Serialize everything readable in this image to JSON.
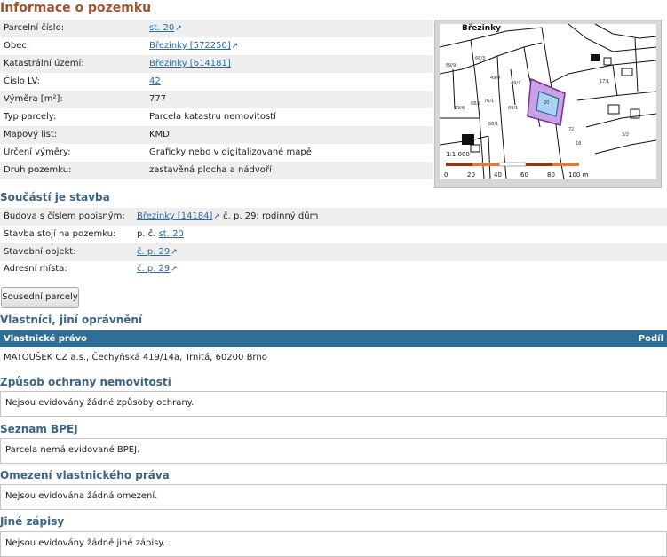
{
  "heading": "Informace o pozemku",
  "parcel_rows": [
    {
      "label": "Parcelní číslo:",
      "value": "st. 20",
      "link": true
    },
    {
      "label": "Obec:",
      "value": "Březinky [572250]",
      "link": true
    },
    {
      "label": "Katastrální území:",
      "value": "Březinky [614181]",
      "link": true
    },
    {
      "label": "Číslo LV:",
      "value": "42",
      "link": true
    },
    {
      "label": "Výměra [m²]:",
      "value": "777",
      "link": false
    },
    {
      "label": "Typ parcely:",
      "value": "Parcela katastru nemovitostí",
      "link": false
    },
    {
      "label": "Mapový list:",
      "value": "KMD",
      "link": false
    },
    {
      "label": "Určení výměry:",
      "value": "Graficky nebo v digitalizované mapě",
      "link": false
    },
    {
      "label": "Druh pozemku:",
      "value": "zastavěná plocha a nádvoří",
      "link": false
    }
  ],
  "building": {
    "heading": "Součástí je stavba",
    "budova_label": "Budova s číslem popisným:",
    "budova_link": "Březinky [14184]",
    "budova_rest": " č. p. 29; rodinný dům",
    "stoji_label": "Stavba stojí na pozemku:",
    "stoji_prefix": "p. č.",
    "stoji_link": "st. 20",
    "objekt_label": "Stavební objekt:",
    "objekt_link": "č. p. 29",
    "adresni_label": "Adresní místa:",
    "adresni_link": "č. p. 29"
  },
  "neighbors_button": "Sousední parcely",
  "owners": {
    "heading": "Vlastníci, jiní oprávnění",
    "col_left": "Vlastnické právo",
    "col_right": "Podíl",
    "owner_text": "MATOUŠEK CZ a.s., Čechyňská 419/14a, Trnitá, 60200 Brno"
  },
  "sections": [
    {
      "heading": "Způsob ochrany nemovitosti",
      "text": "Nejsou evidovány žádné způsoby ochrany."
    },
    {
      "heading": "Seznam BPEJ",
      "text": "Parcela nemá evidované BPEJ."
    },
    {
      "heading": "Omezení vlastnického práva",
      "text": "Nejsou evidována žádná omezení."
    },
    {
      "heading": "Jiné zápisy",
      "text": "Nejsou evidovány žádné jiné zápisy."
    }
  ],
  "map": {
    "place": "Březinky",
    "scale": "1:1 000",
    "scale_ticks": [
      "0",
      "20",
      "40",
      "60",
      "80",
      "100 m"
    ],
    "numbers": [
      "89/9",
      "68/3",
      "49/4",
      "49/7",
      "68/2",
      "76/1",
      "69/1",
      "68/1",
      "89/6",
      "72",
      "17/1",
      "20",
      "18",
      "3/2"
    ],
    "colors": {
      "bar_dark": "#8b3a1b",
      "bar_light": "#e07b39",
      "parcel_fill": "#c7a2e6",
      "parcel_stroke": "#7b2e8e",
      "building_fill": "#a9d3f2"
    }
  }
}
